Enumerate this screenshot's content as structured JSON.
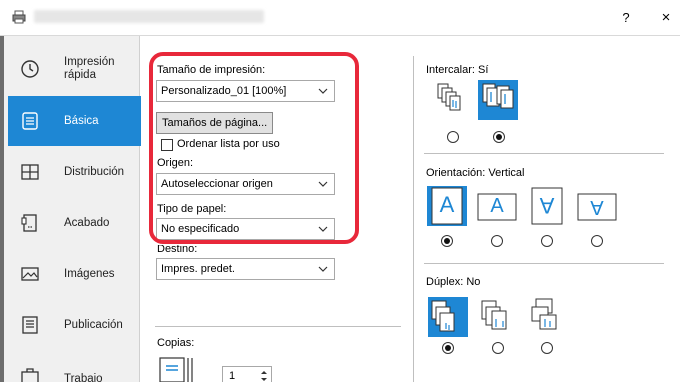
{
  "window": {
    "help_label": "?",
    "close_label": "×"
  },
  "sidebar": {
    "items": [
      {
        "label_line1": "Impresión",
        "label_line2": "rápida",
        "icon": "clock-icon"
      },
      {
        "label_line1": "Básica",
        "label_line2": "",
        "icon": "document-icon",
        "active": true
      },
      {
        "label_line1": "Distribución",
        "label_line2": "",
        "icon": "layout-grid-icon"
      },
      {
        "label_line1": "Acabado",
        "label_line2": "",
        "icon": "finishing-icon"
      },
      {
        "label_line1": "Imágenes",
        "label_line2": "",
        "icon": "image-icon"
      },
      {
        "label_line1": "Publicación",
        "label_line2": "",
        "icon": "publication-icon"
      },
      {
        "label_line1": "Trabajo",
        "label_line2": "",
        "icon": "job-icon"
      }
    ]
  },
  "basic": {
    "print_size_label": "Tamaño de impresión:",
    "print_size_value": "Personalizado_01 [100%]",
    "page_sizes_button": "Tamaños de página...",
    "sort_list_label": "Ordenar lista por uso",
    "source_label": "Origen:",
    "source_value": "Autoseleccionar origen",
    "paper_type_label": "Tipo de papel:",
    "paper_type_value": "No especificado",
    "destination_label": "Destino:",
    "destination_value": "Impres. predet.",
    "copies_label": "Copias:",
    "copies_value": "1"
  },
  "collate": {
    "label": "Intercalar:",
    "value": "Sí"
  },
  "orientation": {
    "label": "Orientación:",
    "value": "Vertical",
    "options": [
      "A",
      "A",
      "A",
      "A"
    ]
  },
  "duplex": {
    "label": "Dúplex:",
    "value": "No"
  },
  "colors": {
    "accent": "#1e87d4",
    "highlight": "#e8283a"
  }
}
